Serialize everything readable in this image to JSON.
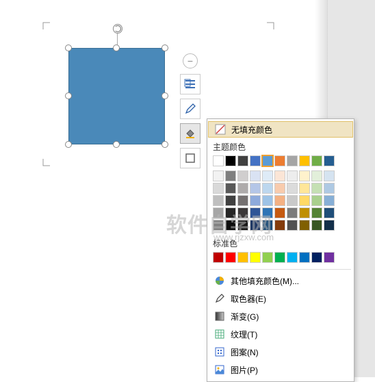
{
  "shape": {
    "fill": "#4a89b9"
  },
  "float_toolbar": {
    "minus": "−"
  },
  "popup": {
    "no_fill": "无填充颜色",
    "theme_label": "主题颜色",
    "standard_label": "标准色",
    "more_colors": "其他填充颜色(M)...",
    "eyedropper": "取色器(E)",
    "gradient": "渐变(G)",
    "texture": "纹理(T)",
    "pattern": "图案(N)",
    "picture": "图片(P)"
  },
  "theme_colors_row": [
    "#ffffff",
    "#000000",
    "#404040",
    "#4472c4",
    "#5b9bd5",
    "#ed7d31",
    "#a5a5a5",
    "#ffc000",
    "#70ad47",
    "#255e91"
  ],
  "theme_tints": [
    [
      "#f2f2f2",
      "#7f7f7f",
      "#d0cece",
      "#d9e2f3",
      "#deebf7",
      "#fbe5d6",
      "#ededed",
      "#fff2cc",
      "#e2efda",
      "#d5e3f0"
    ],
    [
      "#d9d9d9",
      "#595959",
      "#aeabab",
      "#b4c6e7",
      "#bdd7ee",
      "#f8cbad",
      "#dbdbdb",
      "#ffe699",
      "#c5e0b4",
      "#aec9e3"
    ],
    [
      "#bfbfbf",
      "#404040",
      "#757171",
      "#8eaadb",
      "#9dc3e6",
      "#f4b183",
      "#c9c9c9",
      "#ffd966",
      "#a9d08e",
      "#87afd6"
    ],
    [
      "#a6a6a6",
      "#262626",
      "#3b3838",
      "#2f5597",
      "#2e75b6",
      "#c55a11",
      "#7b7b7b",
      "#bf8f00",
      "#548235",
      "#1f4e79"
    ],
    [
      "#808080",
      "#0d0d0d",
      "#181717",
      "#1f3864",
      "#1f4e79",
      "#843c0c",
      "#525252",
      "#806000",
      "#385723",
      "#132f4a"
    ]
  ],
  "standard_colors": [
    "#c00000",
    "#ff0000",
    "#ffc000",
    "#ffff00",
    "#92d050",
    "#00b050",
    "#00b0f0",
    "#0070c0",
    "#002060",
    "#7030a0"
  ],
  "watermark": "软件自学网",
  "watermark_sub": "www.rjzxw.com"
}
